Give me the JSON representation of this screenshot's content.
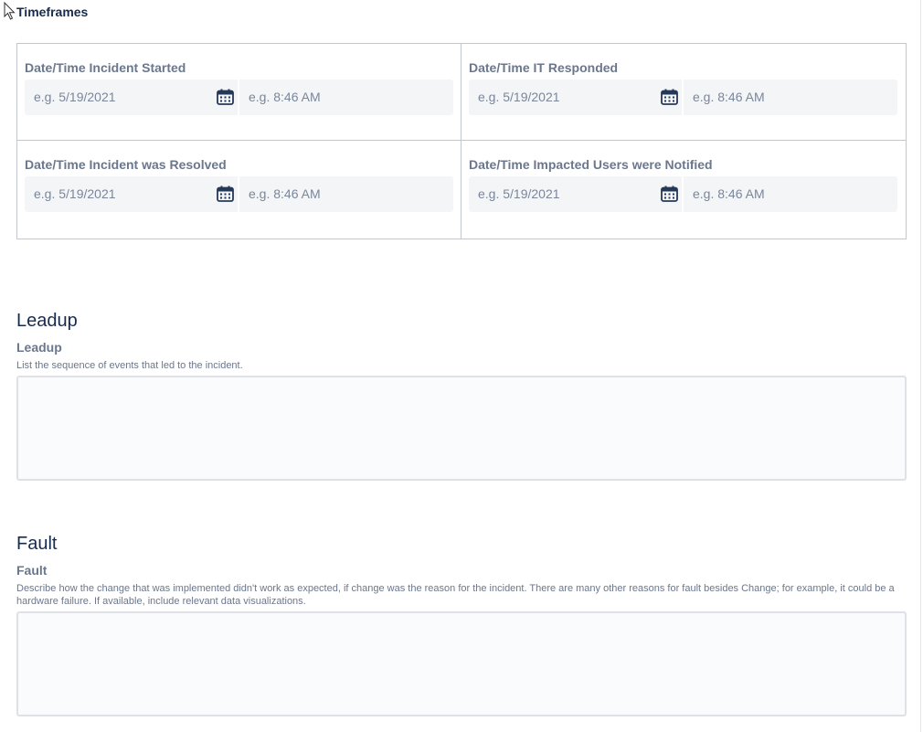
{
  "timeframes": {
    "title": "Timeframes",
    "fields": [
      {
        "label": "Date/Time Incident Started",
        "date_placeholder": "e.g. 5/19/2021",
        "time_placeholder": "e.g. 8:46 AM"
      },
      {
        "label": "Date/Time IT Responded",
        "date_placeholder": "e.g. 5/19/2021",
        "time_placeholder": "e.g. 8:46 AM"
      },
      {
        "label": "Date/Time Incident was Resolved",
        "date_placeholder": "e.g. 5/19/2021",
        "time_placeholder": "e.g. 8:46 AM"
      },
      {
        "label": "Date/Time Impacted Users were Notified",
        "date_placeholder": "e.g. 5/19/2021",
        "time_placeholder": "e.g. 8:46 AM"
      }
    ]
  },
  "leadup": {
    "heading": "Leadup",
    "label": "Leadup",
    "help": "List the sequence of events that led to the incident.",
    "value": ""
  },
  "fault": {
    "heading": "Fault",
    "label": "Fault",
    "help": "Describe how the change that was implemented didn't work as expected, if change was the reason for the incident.  There are many other reasons for fault besides Change; for example, it could be a hardware failure.  If available, include relevant data visualizations.",
    "value": ""
  },
  "icons": {
    "calendar": "calendar-icon",
    "cursor": "mouse-pointer-icon"
  },
  "colors": {
    "text_primary": "#172b4d",
    "text_label": "#6b778c",
    "placeholder": "#7a869a",
    "input_bg": "#f4f5f7",
    "border": "#c1c7d0"
  }
}
